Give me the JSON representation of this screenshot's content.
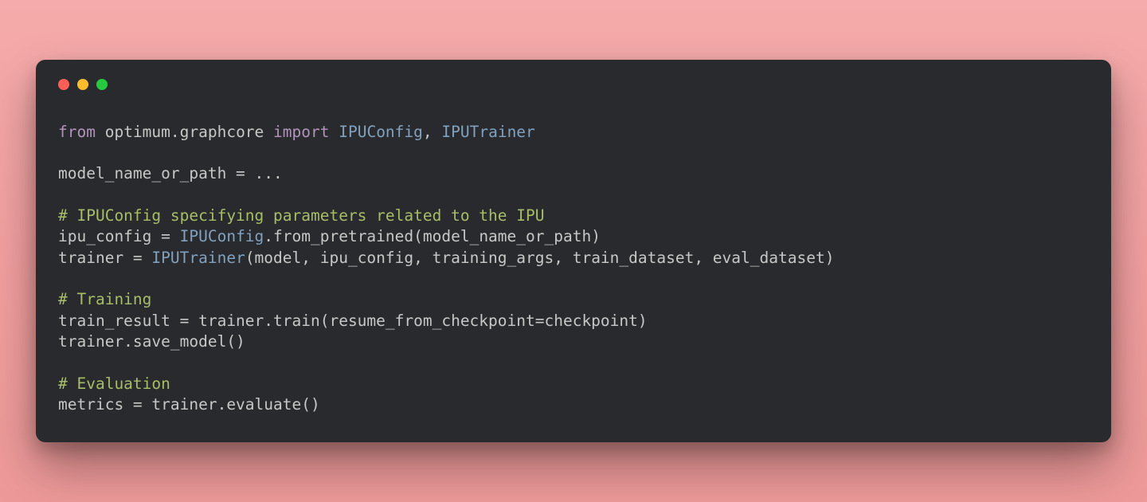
{
  "colors": {
    "bg_gradient_start": "#f5abab",
    "bg_gradient_end": "#ee9999",
    "window_bg": "#282a2e",
    "dot_red": "#ff5f56",
    "dot_yellow": "#ffbd2e",
    "dot_green": "#27c93f",
    "keyword": "#b294bb",
    "class": "#81a2be",
    "comment": "#a7bd68",
    "text": "#c5c8c6"
  },
  "code": {
    "l1_from": "from",
    "l1_module": " optimum.graphcore ",
    "l1_import": "import",
    "l1_space": " ",
    "l1_class1": "IPUConfig",
    "l1_comma": ", ",
    "l1_class2": "IPUTrainer",
    "l3": "model_name_or_path = ...",
    "l5_comment": "# IPUConfig specifying parameters related to the IPU",
    "l6_a": "ipu_config = ",
    "l6_class": "IPUConfig",
    "l6_b": ".from_pretrained(model_name_or_path)",
    "l7_a": "trainer = ",
    "l7_class": "IPUTrainer",
    "l7_b": "(model, ipu_config, training_args, train_dataset, eval_dataset)",
    "l9_comment": "# Training",
    "l10": "train_result = trainer.train(resume_from_checkpoint=checkpoint)",
    "l11": "trainer.save_model()",
    "l13_comment": "# Evaluation",
    "l14": "metrics = trainer.evaluate()"
  }
}
